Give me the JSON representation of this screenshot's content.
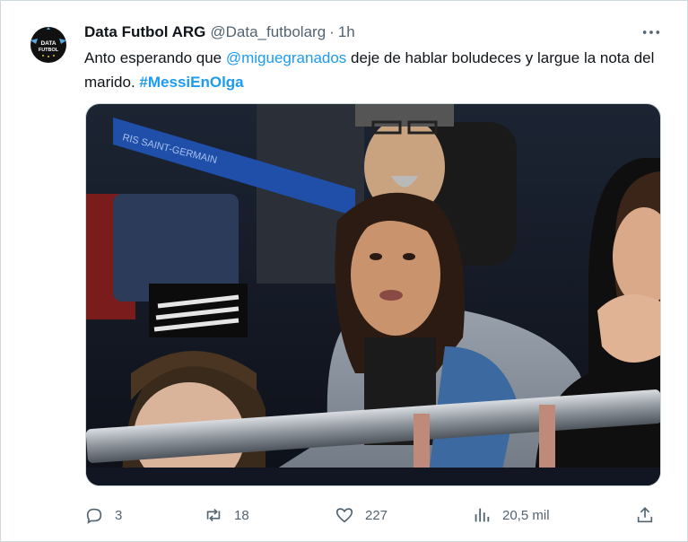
{
  "tweet": {
    "author_name": "Data Futbol ARG",
    "handle": "@Data_futbolarg",
    "separator": "·",
    "time": "1h",
    "avatar_text_line1": "DATA",
    "avatar_text_line2": "FUTBOL",
    "text_part1": "Anto esperando que ",
    "mention": "@miguegranados",
    "text_part2": " deje de hablar boludeces y largue la nota del marido. ",
    "hashtag": "#MessiEnOlga",
    "media_banner_text": "RIS SAINT-GERMAIN"
  },
  "actions": {
    "replies": "3",
    "retweets": "18",
    "likes": "227",
    "views": "20,5 mil"
  },
  "icons": {
    "more": "more-horizontal-icon",
    "reply": "reply-icon",
    "retweet": "retweet-icon",
    "like": "heart-icon",
    "views": "views-chart-icon",
    "share": "share-icon"
  },
  "colors": {
    "text": "#0f1419",
    "secondary": "#536471",
    "link": "#1d9bf0",
    "border": "#cfd9de"
  }
}
